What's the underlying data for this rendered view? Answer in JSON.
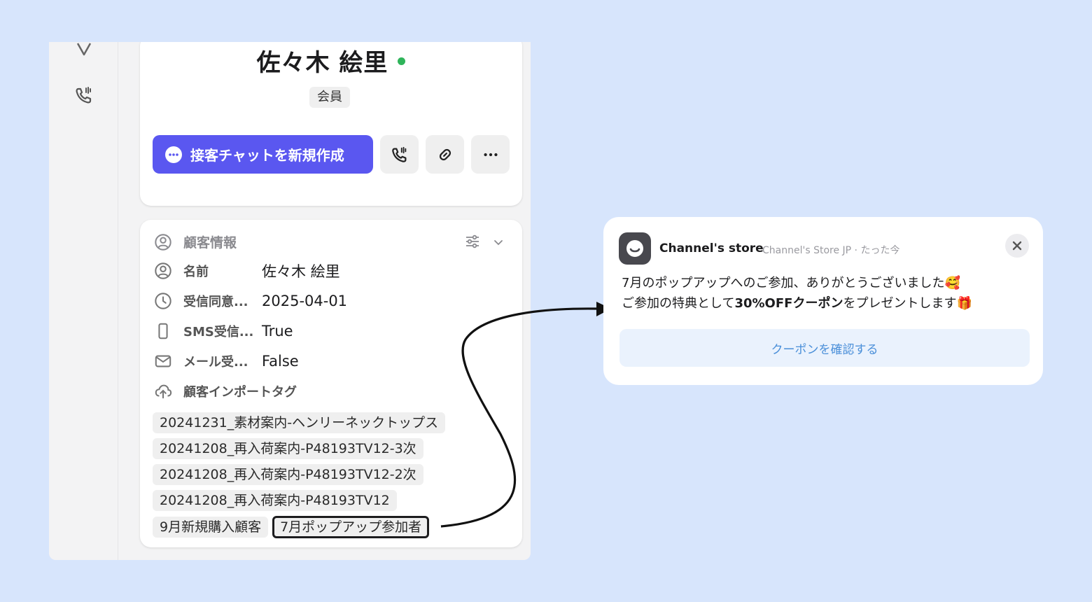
{
  "profile": {
    "name": "佐々木 絵里",
    "badge": "会員",
    "chat_button": "接客チャットを新規作成"
  },
  "customer_info": {
    "title": "顧客情報",
    "rows": [
      {
        "label": "名前",
        "value": "佐々木 絵里",
        "icon": "person-circle-icon"
      },
      {
        "label": "受信同意...",
        "value": "2025-04-01",
        "icon": "clock-icon"
      },
      {
        "label": "SMS受信...",
        "value": "True",
        "icon": "phone-icon"
      },
      {
        "label": "メール受...",
        "value": "False",
        "icon": "mail-icon"
      }
    ],
    "tags_label": "顧客インポートタグ",
    "tags": [
      "20241231_素材案内-ヘンリーネックトップス",
      "20241208_再入荷案内-P48193TV12-3次",
      "20241208_再入荷案内-P48193TV12-2次",
      "20241208_再入荷案内-P48193TV12",
      "9月新規購入顧客",
      "7月ポップアップ参加者"
    ]
  },
  "notification": {
    "store": "Channel's store",
    "meta": "Channel's Store JP · たった今",
    "line1": "7月のポップアップへのご参加、ありがとうございました🥰",
    "line2_pre": "ご参加の特典として",
    "line2_bold": "30%OFFクーポン",
    "line2_post": "をプレゼントします🎁",
    "button": "クーポンを確認する"
  },
  "colors": {
    "background": "#d7e5fc",
    "primary": "#5a57f0",
    "online": "#2fb45a",
    "coupon_text": "#4a8fd9"
  }
}
